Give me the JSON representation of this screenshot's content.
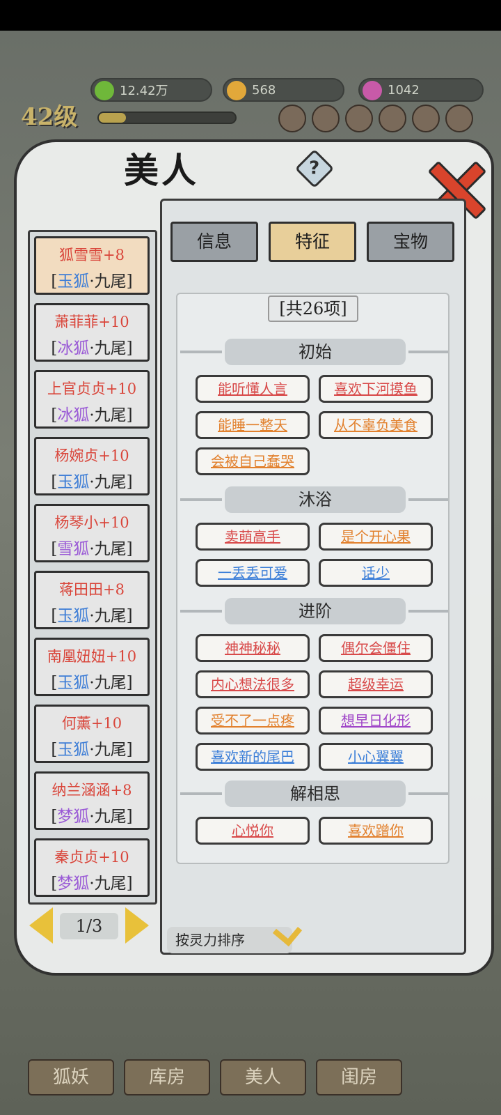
{
  "hud": {
    "spirit": "12.42万",
    "coins": "568",
    "gems": "1042",
    "level": "42级"
  },
  "window": {
    "title": "美人",
    "help": "?"
  },
  "tabs": [
    "信息",
    "特征",
    "宝物"
  ],
  "active_tab": "特征",
  "beauties": [
    {
      "name": "狐雪雪+8",
      "species": "玉狐",
      "tail": "·九尾"
    },
    {
      "name": "萧菲菲+10",
      "species": "冰狐",
      "tail": "·九尾"
    },
    {
      "name": "上官贞贞+10",
      "species": "冰狐",
      "tail": "·九尾"
    },
    {
      "name": "杨婉贞+10",
      "species": "玉狐",
      "tail": "·九尾"
    },
    {
      "name": "杨琴小+10",
      "species": "雪狐",
      "tail": "·九尾"
    },
    {
      "name": "蒋田田+8",
      "species": "玉狐",
      "tail": "·九尾"
    },
    {
      "name": "南凰妞妞+10",
      "species": "玉狐",
      "tail": "·九尾"
    },
    {
      "name": "何薰+10",
      "species": "玉狐",
      "tail": "·九尾"
    },
    {
      "name": "纳兰涵涵+8",
      "species": "梦狐",
      "tail": "·九尾"
    },
    {
      "name": "秦贞贞+10",
      "species": "梦狐",
      "tail": "·九尾"
    }
  ],
  "pager": "1/3",
  "traits": {
    "count": "[共26项]",
    "sections": [
      {
        "title": "初始",
        "items": [
          {
            "label": "能听懂人言",
            "color": "#d84a4a"
          },
          {
            "label": "喜欢下河摸鱼",
            "color": "#d84a4a"
          },
          {
            "label": "能睡一整天",
            "color": "#e2812e"
          },
          {
            "label": "从不辜负美食",
            "color": "#e2812e"
          },
          {
            "label": "会被自己蠢哭",
            "color": "#e2812e"
          }
        ]
      },
      {
        "title": "沐浴",
        "items": [
          {
            "label": "卖萌高手",
            "color": "#d84a4a"
          },
          {
            "label": "是个开心果",
            "color": "#e2812e"
          },
          {
            "label": "一丢丢可爱",
            "color": "#3b7ed8"
          },
          {
            "label": "话少",
            "color": "#3b7ed8"
          }
        ]
      },
      {
        "title": "进阶",
        "items": [
          {
            "label": "神神秘秘",
            "color": "#d84a4a"
          },
          {
            "label": "偶尔会僵住",
            "color": "#d84a4a"
          },
          {
            "label": "内心想法很多",
            "color": "#d84a4a"
          },
          {
            "label": "超级幸运",
            "color": "#d84a4a"
          },
          {
            "label": "受不了一点疼",
            "color": "#e2812e"
          },
          {
            "label": "想早日化形",
            "color": "#a046c8"
          },
          {
            "label": "喜欢新的尾巴",
            "color": "#3b7ed8"
          },
          {
            "label": "小心翼翼",
            "color": "#3b7ed8"
          }
        ]
      },
      {
        "title": "解相思",
        "items": [
          {
            "label": "心悦你",
            "color": "#d84a4a"
          },
          {
            "label": "喜欢蹭你",
            "color": "#e2812e"
          }
        ]
      }
    ]
  },
  "sort_label": "按灵力排序",
  "bottom_nav": [
    "狐妖",
    "库房",
    "美人",
    "闺房"
  ]
}
